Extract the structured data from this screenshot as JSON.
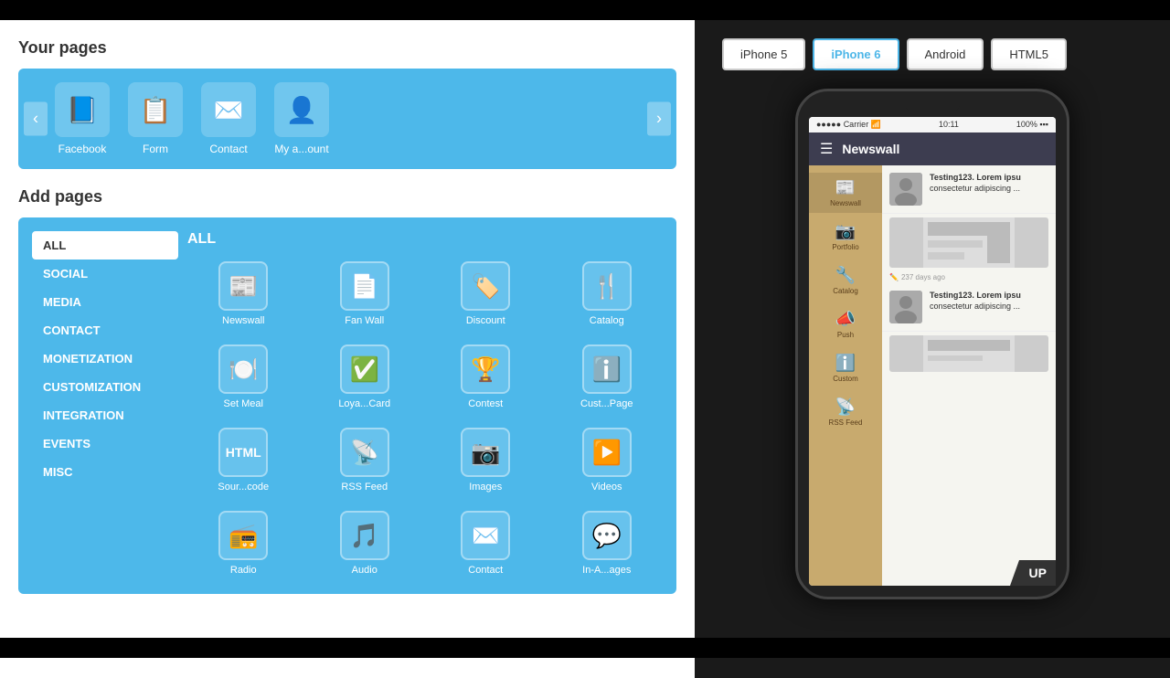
{
  "page": {
    "your_pages_title": "Your pages",
    "add_pages_title": "Add pages"
  },
  "device_buttons": [
    {
      "id": "iphone5",
      "label": "iPhone 5",
      "active": false
    },
    {
      "id": "iphone6",
      "label": "iPhone 6",
      "active": true
    },
    {
      "id": "android",
      "label": "Android",
      "active": false
    },
    {
      "id": "html5",
      "label": "HTML5",
      "active": false
    }
  ],
  "your_pages": [
    {
      "id": "facebook",
      "icon": "📘",
      "label": "Facebook"
    },
    {
      "id": "form",
      "icon": "📋",
      "label": "Form"
    },
    {
      "id": "contact",
      "icon": "✉️",
      "label": "Contact"
    },
    {
      "id": "my-account",
      "icon": "👤",
      "label": "My a...ount"
    }
  ],
  "categories": [
    {
      "id": "all",
      "label": "ALL",
      "active": true
    },
    {
      "id": "social",
      "label": "SOCIAL",
      "active": false
    },
    {
      "id": "media",
      "label": "MEDIA",
      "active": false
    },
    {
      "id": "contact",
      "label": "CONTACT",
      "active": false
    },
    {
      "id": "monetization",
      "label": "MONETIZATION",
      "active": false
    },
    {
      "id": "customization",
      "label": "CUSTOMIZATION",
      "active": false
    },
    {
      "id": "integration",
      "label": "INTEGRATION",
      "active": false
    },
    {
      "id": "events",
      "label": "EVENTS",
      "active": false
    },
    {
      "id": "misc",
      "label": "MISC",
      "active": false
    }
  ],
  "apps_grid_title": "ALL",
  "apps": [
    {
      "id": "newswall",
      "icon": "📰",
      "label": "Newswall"
    },
    {
      "id": "fan-wall",
      "icon": "📄",
      "label": "Fan Wall"
    },
    {
      "id": "discount",
      "icon": "🏷️",
      "label": "Discount"
    },
    {
      "id": "catalog",
      "icon": "🍴",
      "label": "Catalog"
    },
    {
      "id": "set-meal",
      "icon": "🍽️",
      "label": "Set Meal"
    },
    {
      "id": "loyalty-card",
      "icon": "✅",
      "label": "Loya...Card"
    },
    {
      "id": "contest",
      "icon": "🏆",
      "label": "Contest"
    },
    {
      "id": "custom-page",
      "icon": "ℹ️",
      "label": "Cust...Page"
    },
    {
      "id": "source-code",
      "icon": "📄",
      "label": "Sour...code"
    },
    {
      "id": "rss-feed-add",
      "icon": "📡",
      "label": "RSS Feed"
    },
    {
      "id": "images",
      "icon": "📷",
      "label": "Images"
    },
    {
      "id": "videos",
      "icon": "▶️",
      "label": "Videos"
    },
    {
      "id": "radio",
      "icon": "📻",
      "label": "Radio"
    },
    {
      "id": "audio",
      "icon": "🎵",
      "label": "Audio"
    },
    {
      "id": "contact-add",
      "icon": "✉️",
      "label": "Contact"
    },
    {
      "id": "in-app-pages",
      "icon": "💬",
      "label": "In-A...ages"
    }
  ],
  "phone": {
    "status_carrier": "Carrier",
    "status_time": "10:11",
    "nav_title": "Newswall",
    "sidebar_items": [
      {
        "id": "newswall",
        "icon": "📰",
        "label": "Newswall",
        "active": true
      },
      {
        "id": "portfolio",
        "icon": "📷",
        "label": "Portfolio",
        "active": false
      },
      {
        "id": "catalog",
        "icon": "🔧",
        "label": "Catalog",
        "active": false
      },
      {
        "id": "push",
        "icon": "📣",
        "label": "Push",
        "active": false
      },
      {
        "id": "custom",
        "icon": "ℹ️",
        "label": "Custom",
        "active": false
      },
      {
        "id": "rss-feed",
        "icon": "📡",
        "label": "RSS Feed",
        "active": false
      }
    ],
    "news_items": [
      {
        "id": "item1",
        "title": "Testing123. Lorem ipsu",
        "subtitle": "consectetur adipiscing ...",
        "thumb": "👤"
      },
      {
        "id": "item2",
        "title": "Testing123. Lorem ipsu",
        "subtitle": "consectetur adipiscing ...",
        "thumb": "👤"
      }
    ],
    "timestamp": "237 days ago"
  }
}
